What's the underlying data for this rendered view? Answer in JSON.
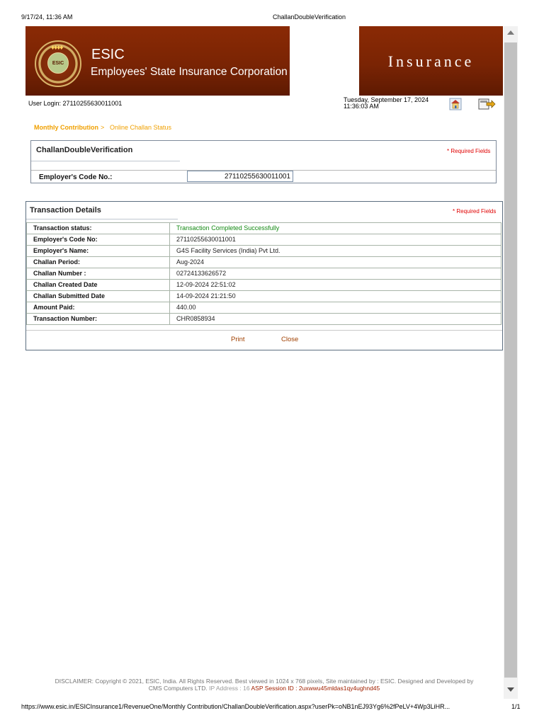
{
  "print": {
    "date": "9/17/24, 11:36 AM",
    "title": "ChallanDoubleVerification",
    "url": "https://www.esic.in/ESICInsurance1/RevenueOne/Monthly Contribution/ChallanDoubleVerification.aspx?userPk=oNB1nEJ93Yg6%2fPeLV+4Wp3LiHR...",
    "page": "1/1"
  },
  "banner": {
    "short_name": "ESIC",
    "full_name": "Employees' State Insurance Corporation",
    "right_text": "Insurance",
    "logo_text": "ESIC"
  },
  "user": {
    "login": "User Login:  27110255630011001",
    "date_line_1": "Tuesday, September 17, 2024",
    "date_line_2": "11:36:03 AM"
  },
  "breadcrumb": {
    "section": "Monthly Contribution",
    "separator": ">",
    "page": "Online Challan Status"
  },
  "verification": {
    "title": "ChallanDoubleVerification",
    "required": "* Required Fields",
    "code_label": "Employer's Code No.:",
    "code_value": "27110255630011001"
  },
  "transaction": {
    "title": "Transaction Details",
    "required": "* Required Fields",
    "rows": [
      {
        "label": "Transaction status:",
        "value": "Transaction Completed Successfully"
      },
      {
        "label": "Employer's Code No:",
        "value": "27110255630011001"
      },
      {
        "label": "Employer's Name:",
        "value": "G4S Facility Services (India) Pvt Ltd."
      },
      {
        "label": "Challan Period:",
        "value": "Aug-2024"
      },
      {
        "label": "Challan Number :",
        "value": "02724133626572"
      },
      {
        "label": "Challan Created Date",
        "value": "12-09-2024 22:51:02"
      },
      {
        "label": "Challan Submitted Date",
        "value": "14-09-2024 21:21:50"
      },
      {
        "label": "Amount Paid:",
        "value": "440.00"
      },
      {
        "label": "Transaction Number:",
        "value": "CHR0858934"
      }
    ],
    "print_label": "Print",
    "close_label": "Close",
    "success_color": "#148a14"
  },
  "disclaimer": {
    "line1": "DISCLAIMER: Copyright © 2021, ESIC, India. All Rights Reserved. Best viewed in 1024 x 768 pixels, Site maintained by : ESIC. Designed and Developed by",
    "line2_a": "CMS Computers LTD.",
    "line2_b": "IP Address : 16",
    "line2_c": "ASP Session ID : 2uxwwu45mldas1qy4ughnd45"
  },
  "colors": {
    "banner": "#7a2404",
    "breadcrumb": "#f0a000",
    "required": "#e00000",
    "link": "#a04000"
  }
}
